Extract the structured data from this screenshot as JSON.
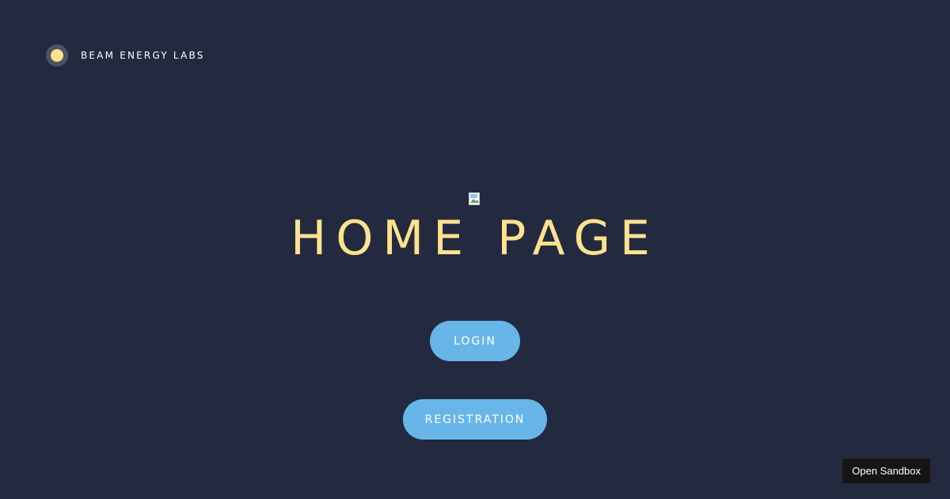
{
  "brand": {
    "name": "BEAM ENERGY LABS",
    "logo_icon": "sun-dot-icon",
    "logo_outer_color": "#4d5366",
    "logo_inner_color": "#ffe28e"
  },
  "hero": {
    "image_icon": "broken-image-icon",
    "title": "HOME PAGE"
  },
  "buttons": {
    "login_label": "LOGIN",
    "registration_label": "REGISTRATION"
  },
  "sandbox": {
    "label": "Open Sandbox"
  },
  "colors": {
    "background": "#232a40",
    "accent": "#ffe28e",
    "button": "#68b6e9"
  }
}
